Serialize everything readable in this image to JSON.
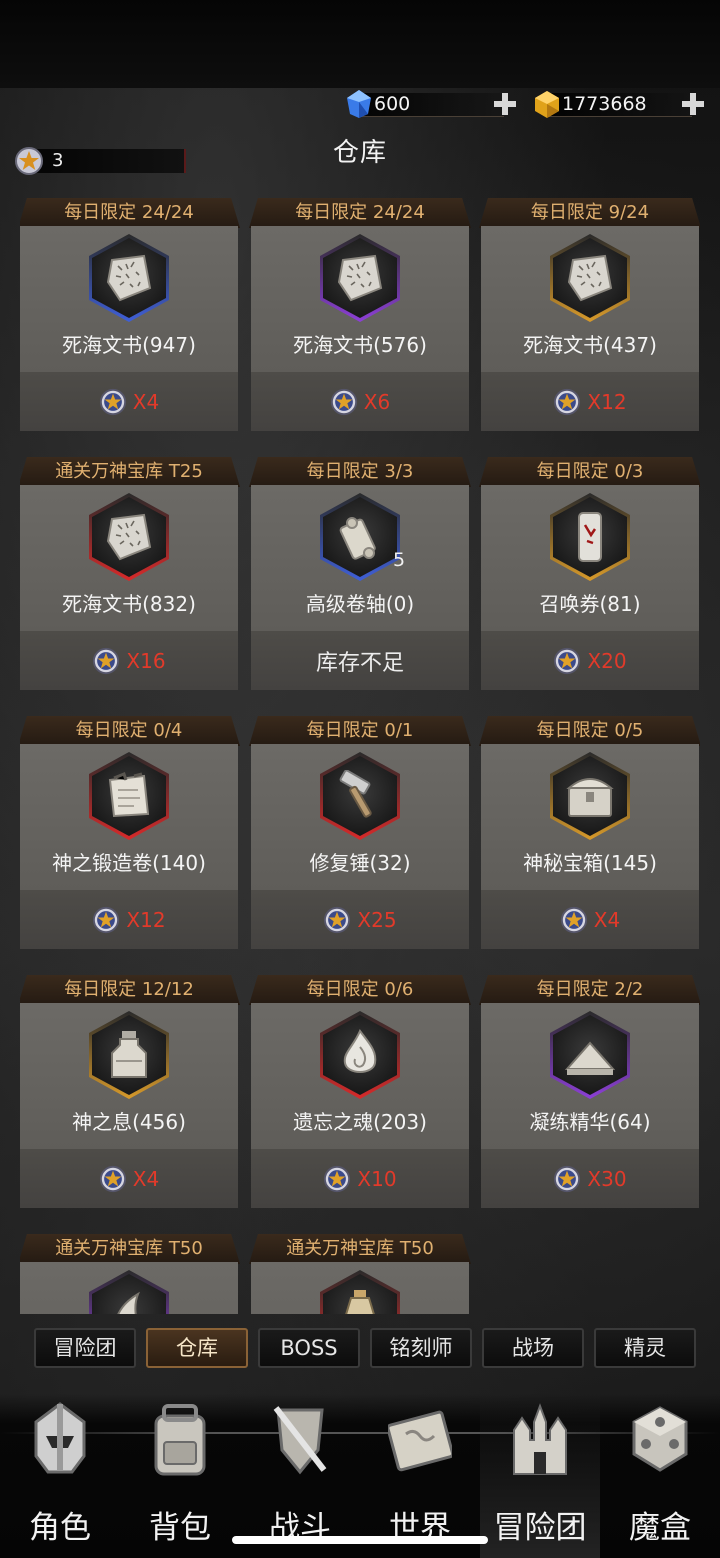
{
  "currency": {
    "diamonds": "600",
    "gold": "1773668",
    "tickets": "3"
  },
  "page_title": "仓库",
  "items": [
    {
      "header": "每日限定 24/24",
      "name": "死海文书(947)",
      "price": "X4",
      "icon": "stone-tablet-icon",
      "frame": "#3f5fd8"
    },
    {
      "header": "每日限定 24/24",
      "name": "死海文书(576)",
      "price": "X6",
      "icon": "stone-tablet-icon",
      "frame": "#8d3fd8"
    },
    {
      "header": "每日限定 9/24",
      "name": "死海文书(437)",
      "price": "X12",
      "icon": "stone-tablet-icon",
      "frame": "#d89a2a"
    },
    {
      "header": "通关万神宝库 T25",
      "name": "死海文书(832)",
      "price": "X16",
      "icon": "stone-tablet-icon",
      "frame": "#d82a2a"
    },
    {
      "header": "每日限定 3/3",
      "name": "高级卷轴(0)",
      "qty": "5",
      "price": "",
      "sold_out": "库存不足",
      "icon": "scroll-icon",
      "frame": "#3f5fd8"
    },
    {
      "header": "每日限定 0/3",
      "name": "召唤券(81)",
      "price": "X20",
      "icon": "summon-ticket-icon",
      "frame": "#d89a2a"
    },
    {
      "header": "每日限定 0/4",
      "name": "神之锻造卷(140)",
      "price": "X12",
      "icon": "forge-scroll-icon",
      "frame": "#d82a2a"
    },
    {
      "header": "每日限定 0/1",
      "name": "修复锤(32)",
      "price": "X25",
      "icon": "hammer-icon",
      "frame": "#d82a2a"
    },
    {
      "header": "每日限定 0/5",
      "name": "神秘宝箱(145)",
      "price": "X4",
      "icon": "treasure-chest-icon",
      "frame": "#d89a2a"
    },
    {
      "header": "每日限定 12/12",
      "name": "神之息(456)",
      "price": "X4",
      "icon": "bottle-icon",
      "frame": "#d89a2a"
    },
    {
      "header": "每日限定 0/6",
      "name": "遗忘之魂(203)",
      "price": "X10",
      "icon": "soul-flame-icon",
      "frame": "#d82a2a"
    },
    {
      "header": "每日限定 2/2",
      "name": "凝练精华(64)",
      "price": "X30",
      "icon": "essence-pile-icon",
      "frame": "#8d3fd8"
    },
    {
      "header": "通关万神宝库 T50",
      "name": "",
      "price": "",
      "icon": "horn-icon",
      "frame": "#8d3fd8"
    },
    {
      "header": "通关万神宝库 T50",
      "name": "",
      "price": "",
      "icon": "potion-icon",
      "frame": "#d82a2a"
    }
  ],
  "tabs": [
    "冒险团",
    "仓库",
    "BOSS",
    "铭刻师",
    "战场",
    "精灵"
  ],
  "active_tab": "仓库",
  "nav": [
    {
      "label": "角色",
      "icon": "helmet-icon"
    },
    {
      "label": "背包",
      "icon": "backpack-icon"
    },
    {
      "label": "战斗",
      "icon": "sword-shield-icon"
    },
    {
      "label": "世界",
      "icon": "map-scroll-icon"
    },
    {
      "label": "冒险团",
      "icon": "castle-icon"
    },
    {
      "label": "魔盒",
      "icon": "magic-cube-icon"
    }
  ],
  "active_nav": "冒险团"
}
